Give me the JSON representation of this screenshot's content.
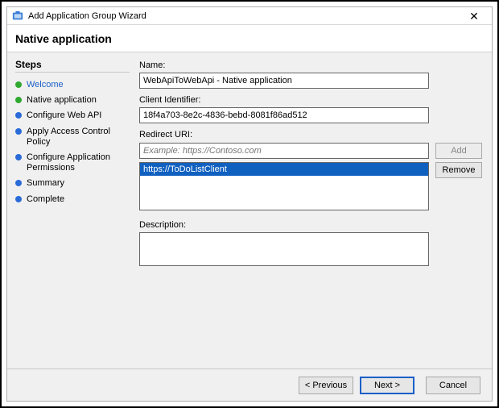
{
  "window": {
    "title": "Add Application Group Wizard",
    "close_glyph": "✕"
  },
  "page_title": "Native application",
  "sidebar": {
    "heading": "Steps",
    "items": [
      {
        "label": "Welcome",
        "state": "done",
        "link": true
      },
      {
        "label": "Native application",
        "state": "done",
        "link": false
      },
      {
        "label": "Configure Web API",
        "state": "pending",
        "link": false
      },
      {
        "label": "Apply Access Control Policy",
        "state": "pending",
        "link": false
      },
      {
        "label": "Configure Application Permissions",
        "state": "pending",
        "link": false
      },
      {
        "label": "Summary",
        "state": "pending",
        "link": false
      },
      {
        "label": "Complete",
        "state": "pending",
        "link": false
      }
    ]
  },
  "form": {
    "name_label": "Name:",
    "name_value": "WebApiToWebApi - Native application",
    "client_id_label": "Client Identifier:",
    "client_id_value": "18f4a703-8e2c-4836-bebd-8081f86ad512",
    "redirect_label": "Redirect URI:",
    "redirect_placeholder": "Example: https://Contoso.com",
    "redirect_value": "",
    "add_label": "Add",
    "remove_label": "Remove",
    "redirect_list": [
      {
        "value": "https://ToDoListClient",
        "selected": true
      }
    ],
    "description_label": "Description:",
    "description_value": ""
  },
  "footer": {
    "previous": "< Previous",
    "next": "Next >",
    "cancel": "Cancel"
  }
}
